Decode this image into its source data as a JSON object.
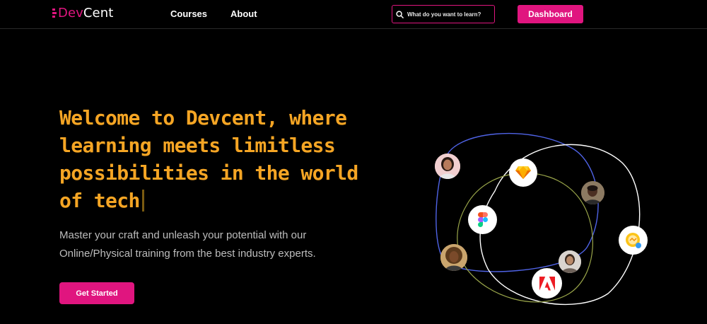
{
  "nav": {
    "logo_prefix": "Dev",
    "logo_suffix": "Cent",
    "links": [
      "Courses",
      "About"
    ],
    "search_placeholder": "What do you want to learn?",
    "dashboard_label": "Dashboard"
  },
  "hero": {
    "title": "Welcome to Devcent, where learning meets limitless possibilities in the world of tech",
    "subtitle": "Master your craft and unleash your potential with our Online/Physical training from the best industry experts.",
    "cta_label": "Get Started"
  },
  "colors": {
    "accent": "#e0157f",
    "headline": "#f5a524",
    "background": "#000000"
  },
  "icons": [
    "search-icon",
    "sketch-icon",
    "figma-icon",
    "adobe-icon",
    "badge-icon"
  ]
}
